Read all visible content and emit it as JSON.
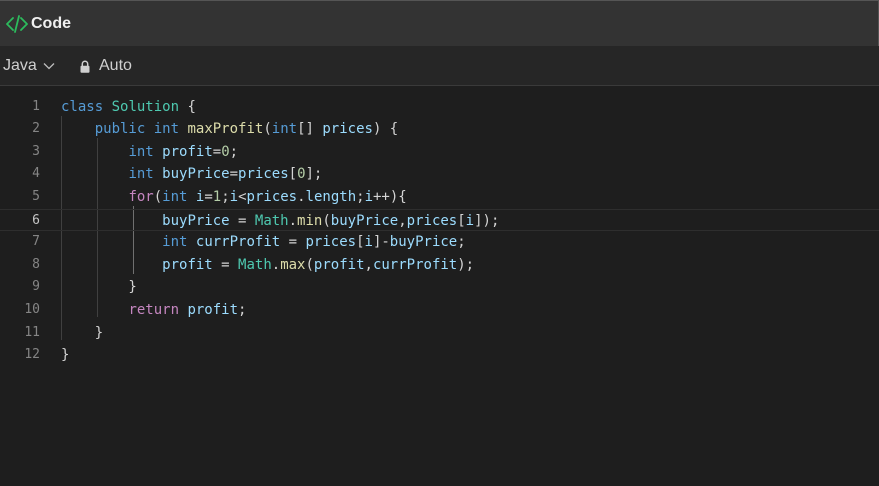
{
  "panel": {
    "title": "Code",
    "title_icon": "code-brackets-icon",
    "accent": "#2cbb5d"
  },
  "toolbar": {
    "language": "Java",
    "mode_label": "Auto",
    "mode_icon": "lock-icon"
  },
  "editor": {
    "current_line": 6,
    "lines": [
      {
        "n": "1",
        "tokens": [
          [
            "kw",
            "class"
          ],
          [
            "p",
            " "
          ],
          [
            "cls",
            "Solution"
          ],
          [
            "p",
            " {"
          ]
        ]
      },
      {
        "n": "2",
        "tokens": [
          [
            "p",
            "    "
          ],
          [
            "kw",
            "public"
          ],
          [
            "p",
            " "
          ],
          [
            "kw",
            "int"
          ],
          [
            "p",
            " "
          ],
          [
            "fn",
            "maxProfit"
          ],
          [
            "p",
            "("
          ],
          [
            "kw",
            "int"
          ],
          [
            "p",
            "[] "
          ],
          [
            "var",
            "prices"
          ],
          [
            "p",
            ") {"
          ]
        ]
      },
      {
        "n": "3",
        "tokens": [
          [
            "p",
            "        "
          ],
          [
            "kw",
            "int"
          ],
          [
            "p",
            " "
          ],
          [
            "var",
            "profit"
          ],
          [
            "p",
            "="
          ],
          [
            "num",
            "0"
          ],
          [
            "p",
            ";"
          ]
        ]
      },
      {
        "n": "4",
        "tokens": [
          [
            "p",
            "        "
          ],
          [
            "kw",
            "int"
          ],
          [
            "p",
            " "
          ],
          [
            "var",
            "buyPrice"
          ],
          [
            "p",
            "="
          ],
          [
            "var",
            "prices"
          ],
          [
            "p",
            "["
          ],
          [
            "num",
            "0"
          ],
          [
            "p",
            "];"
          ]
        ]
      },
      {
        "n": "5",
        "tokens": [
          [
            "p",
            "        "
          ],
          [
            "ctl",
            "for"
          ],
          [
            "p",
            "("
          ],
          [
            "kw",
            "int"
          ],
          [
            "p",
            " "
          ],
          [
            "var",
            "i"
          ],
          [
            "p",
            "="
          ],
          [
            "num",
            "1"
          ],
          [
            "p",
            ";"
          ],
          [
            "var",
            "i"
          ],
          [
            "p",
            "<"
          ],
          [
            "var",
            "prices"
          ],
          [
            "p",
            "."
          ],
          [
            "var",
            "length"
          ],
          [
            "p",
            ";"
          ],
          [
            "var",
            "i"
          ],
          [
            "p",
            "++){"
          ]
        ]
      },
      {
        "n": "6",
        "tokens": [
          [
            "p",
            "            "
          ],
          [
            "var",
            "buyPrice"
          ],
          [
            "p",
            " = "
          ],
          [
            "cls",
            "Math"
          ],
          [
            "p",
            "."
          ],
          [
            "fn",
            "min"
          ],
          [
            "p",
            "("
          ],
          [
            "var",
            "buyPrice"
          ],
          [
            "p",
            ","
          ],
          [
            "var",
            "prices"
          ],
          [
            "p",
            "["
          ],
          [
            "var",
            "i"
          ],
          [
            "p",
            "]);"
          ]
        ]
      },
      {
        "n": "7",
        "tokens": [
          [
            "p",
            "            "
          ],
          [
            "kw",
            "int"
          ],
          [
            "p",
            " "
          ],
          [
            "var",
            "currProfit"
          ],
          [
            "p",
            " = "
          ],
          [
            "var",
            "prices"
          ],
          [
            "p",
            "["
          ],
          [
            "var",
            "i"
          ],
          [
            "p",
            "]-"
          ],
          [
            "var",
            "buyPrice"
          ],
          [
            "p",
            ";"
          ]
        ]
      },
      {
        "n": "8",
        "tokens": [
          [
            "p",
            "            "
          ],
          [
            "var",
            "profit"
          ],
          [
            "p",
            " = "
          ],
          [
            "cls",
            "Math"
          ],
          [
            "p",
            "."
          ],
          [
            "fn",
            "max"
          ],
          [
            "p",
            "("
          ],
          [
            "var",
            "profit"
          ],
          [
            "p",
            ","
          ],
          [
            "var",
            "currProfit"
          ],
          [
            "p",
            ");"
          ]
        ]
      },
      {
        "n": "9",
        "tokens": [
          [
            "p",
            "        }"
          ]
        ]
      },
      {
        "n": "10",
        "tokens": [
          [
            "p",
            "        "
          ],
          [
            "ctl",
            "return"
          ],
          [
            "p",
            " "
          ],
          [
            "var",
            "profit"
          ],
          [
            "p",
            ";"
          ]
        ]
      },
      {
        "n": "11",
        "tokens": [
          [
            "p",
            "    }"
          ]
        ]
      },
      {
        "n": "12",
        "tokens": [
          [
            "p",
            "}"
          ]
        ]
      }
    ]
  }
}
